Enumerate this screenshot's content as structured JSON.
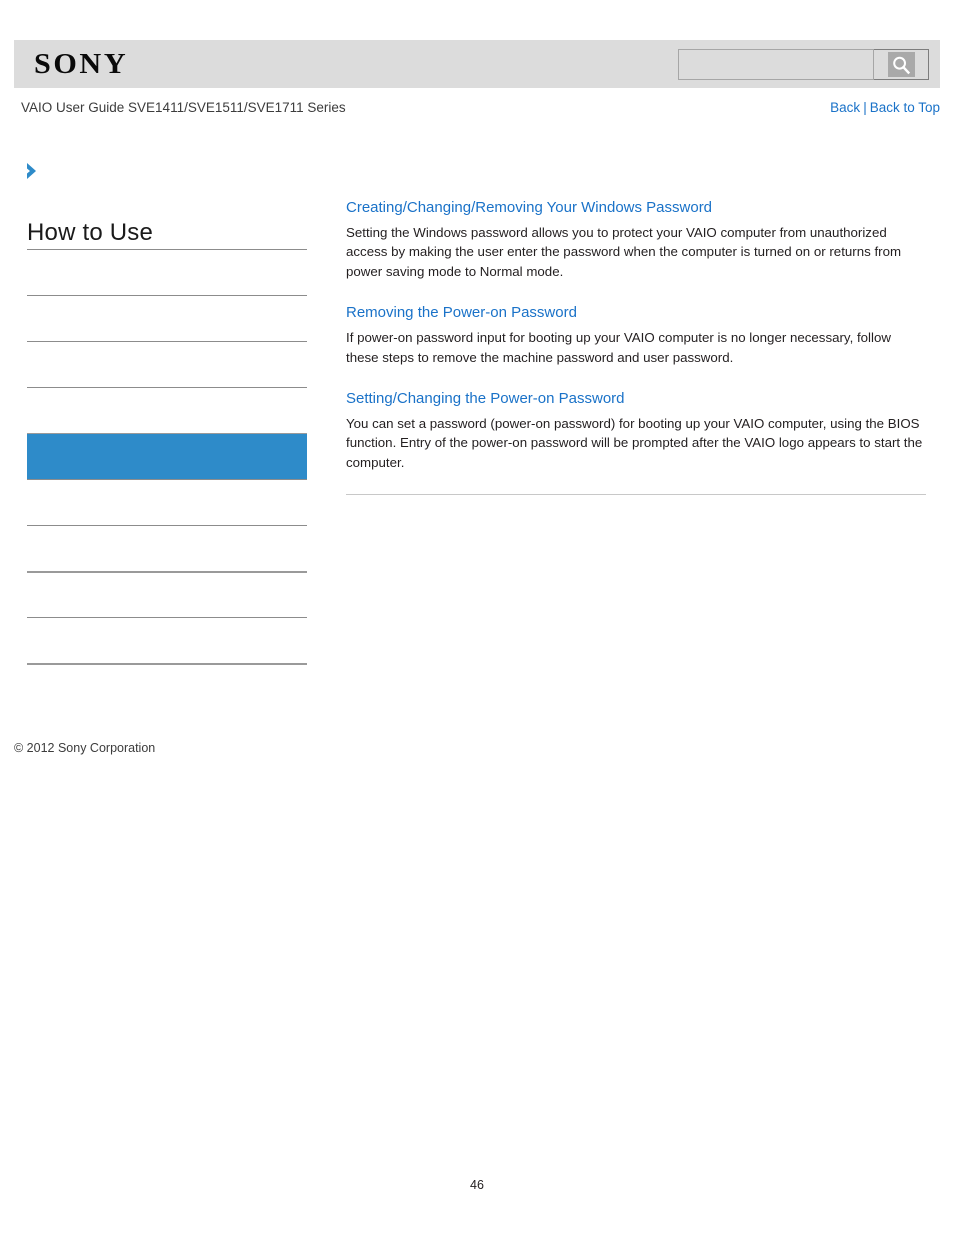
{
  "header": {
    "logo_text": "SONY",
    "logo_icon": "sony-wordmark",
    "search": {
      "value": "",
      "placeholder": "",
      "button_icon": "search-icon"
    }
  },
  "title_row": {
    "guide_title": "VAIO User Guide SVE1411/SVE1511/SVE1711 Series",
    "back_label": "Back",
    "separator": "|",
    "back_to_top_label": "Back to Top"
  },
  "sidebar": {
    "expand_icon": "chevron-right-icon",
    "heading": "How to Use",
    "items": [
      {
        "label": "",
        "active": false,
        "rule": "thin"
      },
      {
        "label": "",
        "active": false,
        "rule": "thin"
      },
      {
        "label": "",
        "active": false,
        "rule": "thin"
      },
      {
        "label": "",
        "active": false,
        "rule": "thin"
      },
      {
        "label": "",
        "active": true,
        "rule": "thin"
      },
      {
        "label": "",
        "active": false,
        "rule": "thin"
      },
      {
        "label": "",
        "active": false,
        "rule": "thin"
      },
      {
        "label": "",
        "active": false,
        "rule": "thick"
      },
      {
        "label": "",
        "active": false,
        "rule": "thin"
      }
    ],
    "copyright": "© 2012 Sony Corporation"
  },
  "main": {
    "sections": [
      {
        "link": "Creating/Changing/Removing Your Windows Password",
        "description": "Setting the Windows password allows you to protect your VAIO computer from unauthorized access by making the user enter the password when the computer is turned on or returns from power saving mode to Normal mode."
      },
      {
        "link": "Removing the Power-on Password",
        "description": "If power-on password input for booting up your VAIO computer is no longer necessary, follow these steps to remove the machine password and user password."
      },
      {
        "link": "Setting/Changing the Power-on Password",
        "description": "You can set a password (power-on password) for booting up your VAIO computer, using the BIOS function. Entry of the power-on password will be prompted after the VAIO logo appears to start the computer."
      }
    ]
  },
  "footer": {
    "page_number": "46"
  },
  "colors": {
    "accent_blue": "#2e8bc9",
    "link_blue": "#1a72c8",
    "header_gray": "#dcdcdc",
    "rule_gray": "#8c8c8c"
  }
}
